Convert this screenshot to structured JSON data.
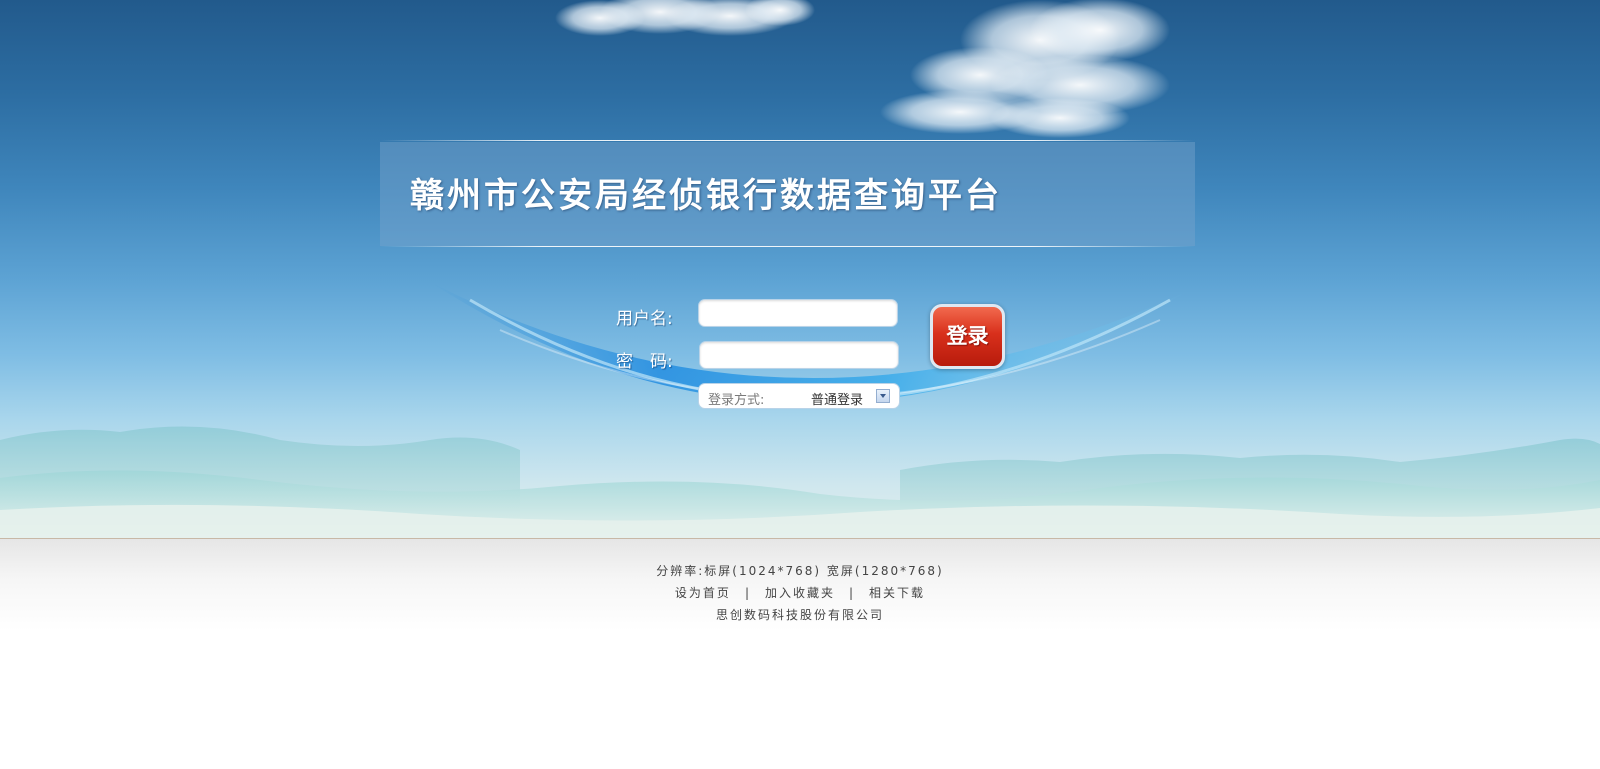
{
  "page": {
    "title": "赣州市公安局经侦银行数据查询平台"
  },
  "login_form": {
    "username_label": "用户名:",
    "password_label": "密　码:",
    "username_value": "",
    "password_value": "",
    "mode_label": "登录方式:",
    "mode_value": "普通登录",
    "submit_label": "登录"
  },
  "footer": {
    "resolution_text": "分辨率:标屏(1024*768) 宽屏(1280*768)",
    "links": [
      "设为首页",
      "加入收藏夹",
      "相关下载"
    ],
    "separator": "|",
    "company": "思创数码科技股份有限公司"
  },
  "colors": {
    "sky_top": "#225a8c",
    "sky_mid": "#5da3d4",
    "login_button": "#d8301c",
    "footer_text": "#444444"
  },
  "icons": {
    "mode_dropdown": "chevron-down-icon"
  }
}
